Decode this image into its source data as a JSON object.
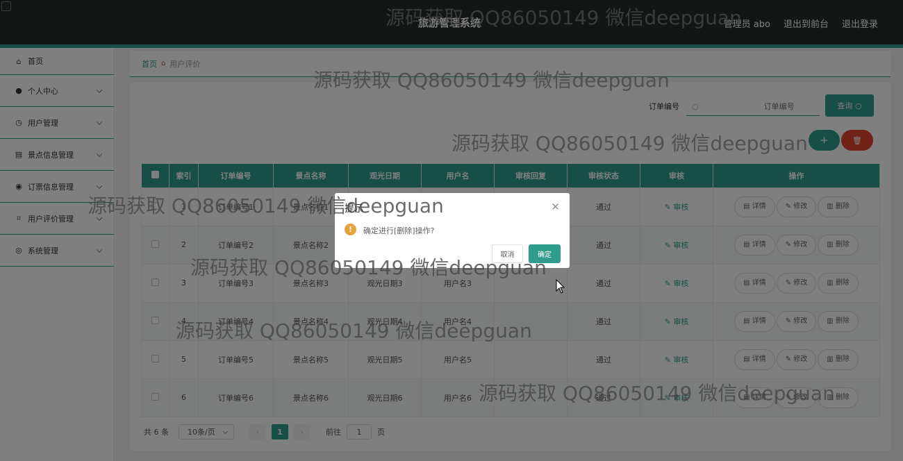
{
  "header": {
    "title": "旅游管理系统",
    "admin": "管理员 abo",
    "front": "退出到前台",
    "logout": "退出登录"
  },
  "sidebar": {
    "items": [
      {
        "label": "首页",
        "icon": "home-icon",
        "glyph": "⌂",
        "chevron": false
      },
      {
        "label": "个人中心",
        "icon": "user-icon",
        "glyph": "●",
        "chevron": true
      },
      {
        "label": "用户管理",
        "icon": "clock-icon",
        "glyph": "◷",
        "chevron": true
      },
      {
        "label": "景点信息管理",
        "icon": "clipboard-icon",
        "glyph": "▤",
        "chevron": true
      },
      {
        "label": "订票信息管理",
        "icon": "pin-icon",
        "glyph": "◉",
        "chevron": true
      },
      {
        "label": "用户评价管理",
        "icon": "crop-icon",
        "glyph": "⌗",
        "chevron": true
      },
      {
        "label": "系统管理",
        "icon": "compass-icon",
        "glyph": "◎",
        "chevron": true
      }
    ]
  },
  "breadcrumb": {
    "home": "首页",
    "current": "用户评价"
  },
  "search": {
    "label": "订单编号",
    "placeholder": "订单编号",
    "query": "查询"
  },
  "buttons": {
    "add": "+",
    "delete": "🗑"
  },
  "table": {
    "headers": [
      "",
      "索引",
      "订单编号",
      "景点名称",
      "观光日期",
      "用户名",
      "审核回复",
      "审核状态",
      "审核",
      "操作"
    ],
    "rows": [
      {
        "index": "1",
        "order": "订单编号1",
        "spot": "景点名称1",
        "date": "观光日期1",
        "user": "用户名1",
        "reply": "",
        "status": "通过"
      },
      {
        "index": "2",
        "order": "订单编号2",
        "spot": "景点名称2",
        "date": "观光日期2",
        "user": "用户名2",
        "reply": "",
        "status": "通过"
      },
      {
        "index": "3",
        "order": "订单编号3",
        "spot": "景点名称3",
        "date": "观光日期3",
        "user": "用户名3",
        "reply": "",
        "status": "通过"
      },
      {
        "index": "4",
        "order": "订单编号4",
        "spot": "景点名称4",
        "date": "观光日期4",
        "user": "用户名4",
        "reply": "",
        "status": "通过"
      },
      {
        "index": "5",
        "order": "订单编号5",
        "spot": "景点名称5",
        "date": "观光日期5",
        "user": "用户名5",
        "reply": "",
        "status": "通过"
      },
      {
        "index": "6",
        "order": "订单编号6",
        "spot": "景点名称6",
        "date": "观光日期6",
        "user": "用户名6",
        "reply": "",
        "status": "通过"
      }
    ],
    "audit_label": "审核",
    "detail_label": "详情",
    "edit_label": "修改",
    "delete_label": "删除"
  },
  "pagination": {
    "total": "共 6 条",
    "page_size": "10条/页",
    "current": "1",
    "goto_prefix": "前往",
    "goto_value": "1",
    "goto_suffix": "页"
  },
  "dialog": {
    "title": "提示",
    "message": "确定进行[删除]操作?",
    "cancel": "取消",
    "confirm": "确定"
  },
  "watermark": "源码获取 QQ86050149 微信deepguan",
  "colors": {
    "accent": "#2f9c8c",
    "danger": "#e0452c",
    "header": "#242f2d"
  }
}
